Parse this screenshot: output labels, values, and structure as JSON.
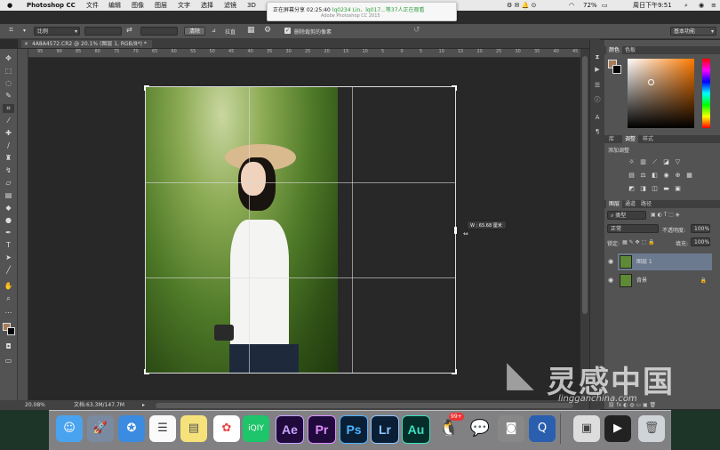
{
  "menubar": {
    "app_name": "Photoshop CC",
    "items": [
      "文件",
      "编辑",
      "图像",
      "图层",
      "文字",
      "选择",
      "滤镜",
      "3D"
    ],
    "battery": "72%",
    "clock": "周日下午9:51"
  },
  "share_banner": {
    "label": "正在屏幕分享 02:25:40",
    "viewers": "lq0234 Lin、lq017...等37人正在观看",
    "sub": "Adobe Photoshop CC 2015"
  },
  "options_bar": {
    "ratio_select": "比例",
    "clear_button": "清除",
    "straighten_label": "拉直",
    "delete_cropped_label": "删除裁剪的像素",
    "workspace_select": "基本功能"
  },
  "document": {
    "tab_title": "4A8A4572.CR2 @ 20.1% (图层 1, RGB/8*) *",
    "zoom": "20.08%",
    "doc_info": "文档:63.3M/147.7M",
    "crop_tooltip": "W : 65.68 厘米"
  },
  "ruler_top_ticks": [
    "95",
    "90",
    "85",
    "80",
    "75",
    "70",
    "65",
    "60",
    "55",
    "50",
    "45",
    "40",
    "35",
    "30",
    "25",
    "20",
    "15",
    "10",
    "5",
    "0",
    "5",
    "10",
    "15",
    "20",
    "25",
    "30",
    "35",
    "40",
    "45",
    "50"
  ],
  "panels": {
    "color_tabs": [
      "颜色",
      "色板"
    ],
    "adjust_tabs": [
      "库",
      "调整",
      "样式"
    ],
    "adjust_title": "添加调整",
    "layers_tabs": [
      "图层",
      "通道",
      "路径"
    ],
    "kind_select": "类型",
    "blend_mode": "正常",
    "opacity_label": "不透明度:",
    "opacity_value": "100%",
    "lock_label": "锁定:",
    "fill_label": "填充:",
    "fill_value": "100%",
    "layers": [
      {
        "name": "图层 1"
      },
      {
        "name": "背景"
      }
    ]
  },
  "colors": {
    "foreground": "#a57c5a",
    "background": "#000000",
    "selected_layer": "#6b7a8f"
  },
  "dock_labels": {
    "ae": "Ae",
    "pr": "Pr",
    "ps": "Ps",
    "lr": "Lr",
    "au": "Au",
    "qq_badge": "99+"
  },
  "watermark": {
    "text": "灵感中国",
    "url": "lingganchina.com"
  }
}
